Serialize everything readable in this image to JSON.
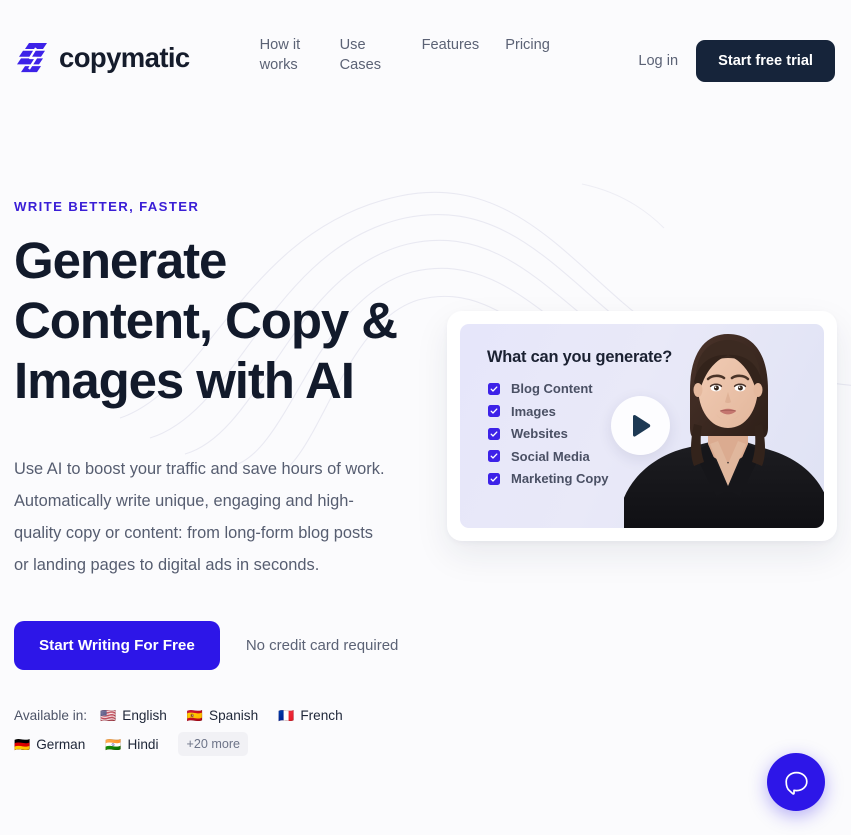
{
  "brand": {
    "name": "copymatic",
    "logo_icon": "copymatic-bars-logo",
    "accent": "#3d22e8"
  },
  "nav": {
    "items": [
      {
        "label": "How it works"
      },
      {
        "label": "Use Cases"
      },
      {
        "label": "Features"
      },
      {
        "label": "Pricing"
      }
    ],
    "login_label": "Log in",
    "trial_label": "Start free trial",
    "trial_bg": "#16243a"
  },
  "hero": {
    "eyebrow": "WRITE BETTER, FASTER",
    "headline": "Generate Content, Copy & Images with AI",
    "subcopy": "Use AI to boost your traffic and save hours of work. Automatically write unique, engaging and high-quality copy or content: from long-form blog posts or landing pages to digital ads in seconds.",
    "cta_label": "Start Writing For Free",
    "cta_bg": "#2d16e8",
    "cta_note": "No credit card required",
    "languages_label": "Available in:",
    "languages": [
      {
        "flag": "🇺🇸",
        "name": "English"
      },
      {
        "flag": "🇪🇸",
        "name": "Spanish"
      },
      {
        "flag": "🇫🇷",
        "name": "French"
      },
      {
        "flag": "🇩🇪",
        "name": "German"
      },
      {
        "flag": "🇮🇳",
        "name": "Hindi"
      }
    ],
    "more_languages_label": "+20 more"
  },
  "video": {
    "thumb_title": "What can you generate?",
    "items": [
      {
        "label": "Blog Content"
      },
      {
        "label": "Images"
      },
      {
        "label": "Websites"
      },
      {
        "label": "Social Media"
      },
      {
        "label": "Marketing Copy"
      }
    ],
    "play_icon": "play-triangle-icon",
    "presenter_alt": "presenter-woman"
  },
  "beacon": {
    "icon": "chat-bubble-icon",
    "color": "#2d16e8"
  }
}
